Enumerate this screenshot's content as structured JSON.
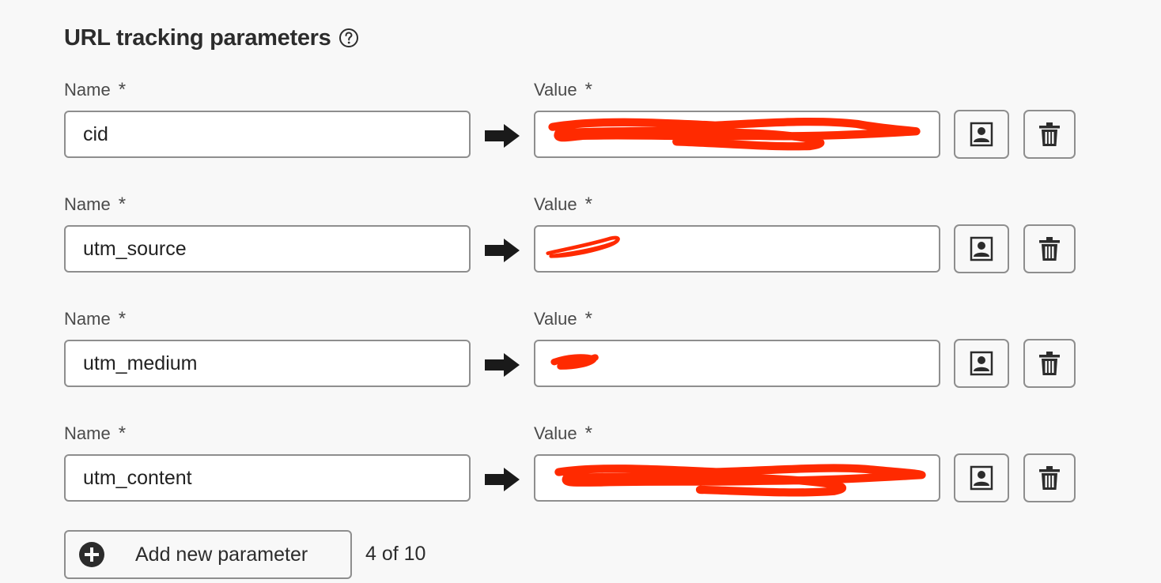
{
  "section": {
    "title": "URL tracking parameters",
    "help_icon": "help-circle-icon"
  },
  "labels": {
    "name": "Name",
    "value": "Value",
    "required_marker": "*"
  },
  "parameters": [
    {
      "name": "cid",
      "value_redacted": true
    },
    {
      "name": "utm_source",
      "value_redacted": true
    },
    {
      "name": "utm_medium",
      "value_redacted": true
    },
    {
      "name": "utm_content",
      "value_redacted": true
    }
  ],
  "icons": {
    "arrow": "arrow-right-icon",
    "personalize": "personalization-icon",
    "delete": "trash-icon",
    "add": "add-circle-icon"
  },
  "footer": {
    "add_label": "Add new parameter",
    "count": "4 of 10"
  },
  "colors": {
    "background": "#f8f8f8",
    "border": "#8e8e8e",
    "redaction": "#ff2a00",
    "text": "#222222"
  }
}
